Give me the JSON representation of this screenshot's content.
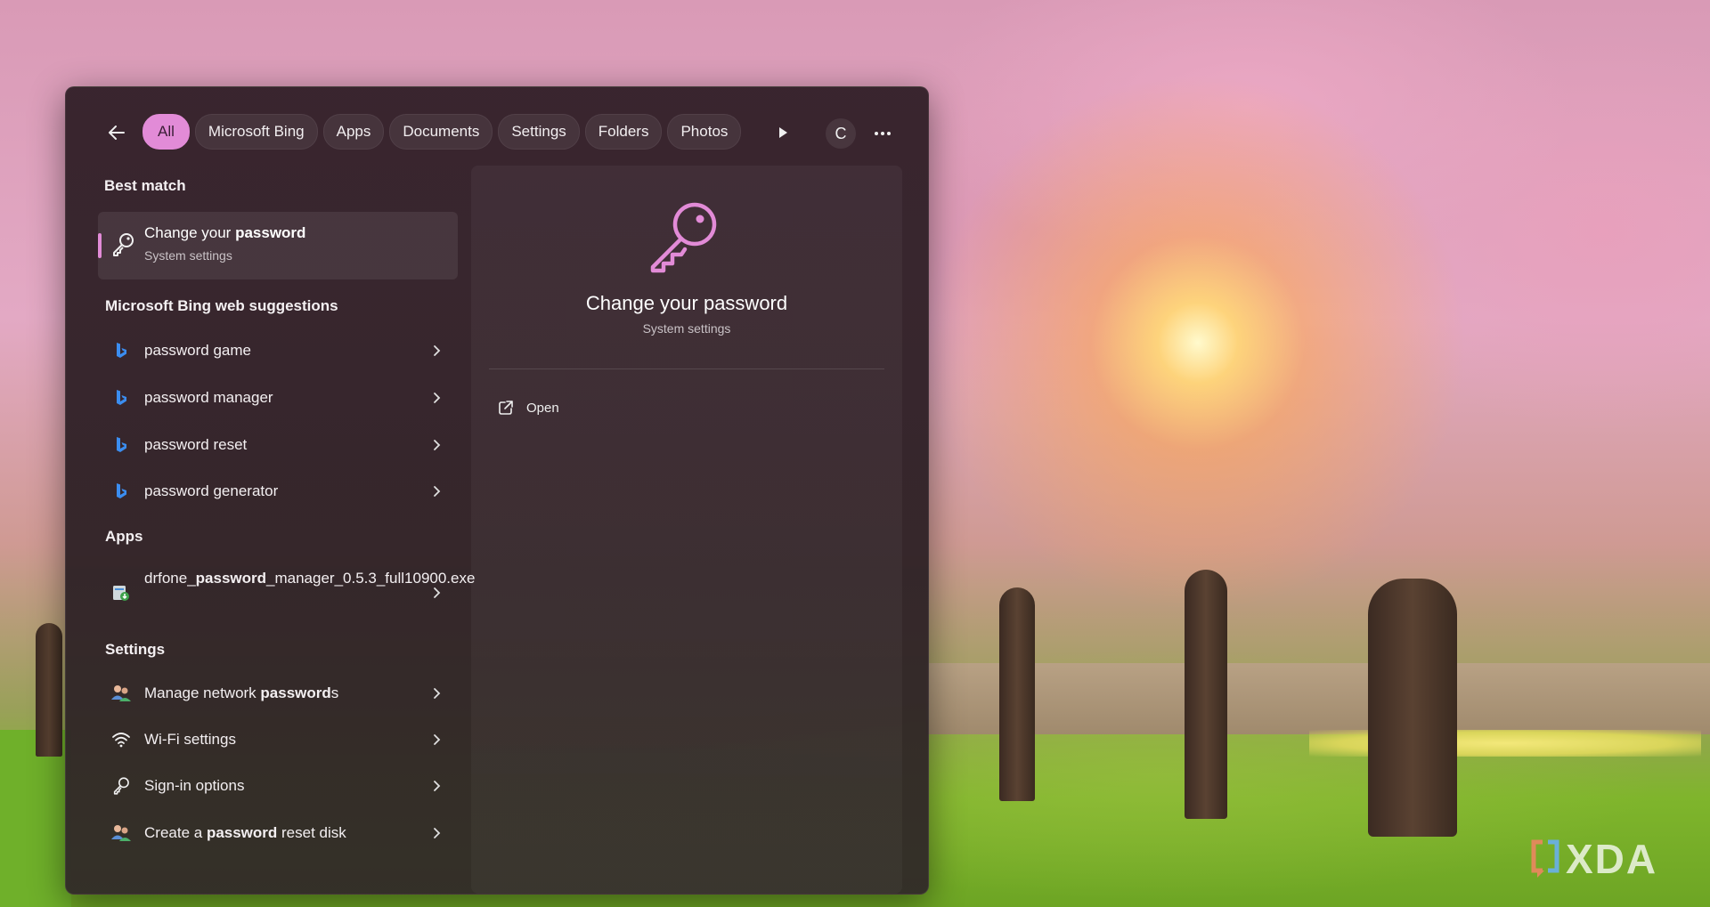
{
  "colors": {
    "accent": "#e28bd7",
    "panel": "#342129",
    "bing_blue": "#3b8df0"
  },
  "toolbar": {
    "back_icon": "back-arrow-icon",
    "filters": [
      {
        "label": "All",
        "active": true
      },
      {
        "label": "Microsoft Bing",
        "active": false
      },
      {
        "label": "Apps",
        "active": false
      },
      {
        "label": "Documents",
        "active": false
      },
      {
        "label": "Settings",
        "active": false
      },
      {
        "label": "Folders",
        "active": false
      },
      {
        "label": "Photos",
        "active": false
      }
    ],
    "more_filters_icon": "play-arrow-icon",
    "avatar_letter": "C",
    "options_icon": "more-dots-icon"
  },
  "results": {
    "best_match_heading": "Best match",
    "best_match": {
      "title_pre": "Change your ",
      "title_bold": "password",
      "subtitle": "System settings",
      "icon": "key-icon"
    },
    "bing_heading": "Microsoft Bing web suggestions",
    "bing_items": [
      {
        "label": "password game"
      },
      {
        "label": "password manager"
      },
      {
        "label": "password reset"
      },
      {
        "label": "password generator"
      }
    ],
    "apps_heading": "Apps",
    "apps_items": [
      {
        "pre": "drfone_",
        "bold": "password",
        "post": "_manager_0.5.3_full10900.exe",
        "icon": "installer-icon"
      }
    ],
    "settings_heading": "Settings",
    "settings_items": [
      {
        "pre": "Manage network ",
        "bold": "password",
        "post": "s",
        "icon": "users-icon"
      },
      {
        "pre": "Wi-Fi settings",
        "bold": "",
        "post": "",
        "icon": "wifi-icon"
      },
      {
        "pre": "Sign-in options",
        "bold": "",
        "post": "",
        "icon": "key-icon"
      },
      {
        "pre": "Create a ",
        "bold": "password",
        "post": " reset disk",
        "icon": "users-icon"
      }
    ]
  },
  "detail": {
    "title": "Change your password",
    "subtitle": "System settings",
    "action_label": "Open",
    "action_icon": "open-external-icon"
  },
  "watermark": {
    "text": "XDA"
  }
}
